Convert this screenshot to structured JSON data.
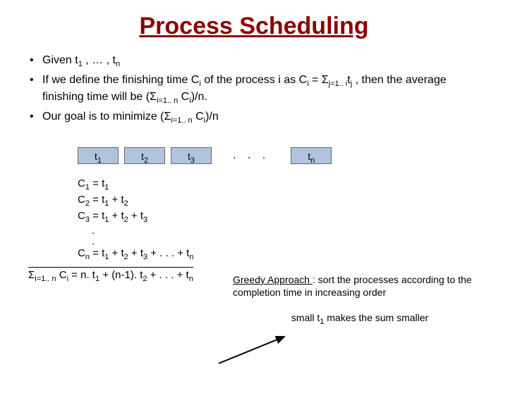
{
  "title": "Process Scheduling",
  "bullets": {
    "b1_pre": "Given t",
    "b1_sub1": "1",
    "b1_mid": " , … , t",
    "b1_sub2": "n",
    "b2_a": "If we define the finishing time C",
    "b2_s1": "i",
    "b2_b": " of the process i as C",
    "b2_s2": "i",
    "b2_c": " = Σ",
    "b2_s3": "j=1.. i",
    "b2_d": "t",
    "b2_s4": "j",
    "b2_e": " , then the average finishing time will be  (Σ",
    "b2_s5": "i=1.. n",
    "b2_f": " C",
    "b2_s6": "i",
    "b2_g": ")/n.",
    "b3_a": "Our goal is to minimize (Σ",
    "b3_s1": "i=1.. n",
    "b3_b": " C",
    "b3_s2": "i",
    "b3_c": ")/n"
  },
  "boxes": {
    "t1a": "t",
    "t1s": "1",
    "t2a": "t",
    "t2s": "2",
    "t3a": "t",
    "t3s": "3",
    "dots": ". . .",
    "tna": "t",
    "tns": "n"
  },
  "calcs": {
    "l1a": "C",
    "l1s1": "1",
    "l1b": " = t",
    "l1s2": "1",
    "l2a": "C",
    "l2s1": "2",
    "l2b": " = t",
    "l2s2": "1",
    "l2c": " + t",
    "l2s3": "2",
    "l3a": "C",
    "l3s1": "3",
    "l3b": " = t",
    "l3s2": "1",
    "l3c": " + t",
    "l3s3": "2",
    "l3d": " + t",
    "l3s4": "3",
    "dot": ".",
    "lna": "C",
    "lns1": "n",
    "lnb": " = t",
    "lns2": "1",
    "lnc": " + t",
    "lns3": "2",
    "lnd": " + t",
    "lns4": "3",
    "lne": " + . . . + t",
    "lns5": "n"
  },
  "sum": {
    "a": "Σ",
    "s1": "i=1.. n",
    "b": " C",
    "s2": "i",
    "c": " = n. t",
    "s3": "1",
    "d": " + (n-1). t",
    "s4": "2",
    "e": " + . . . + t",
    "s5": "n"
  },
  "right": {
    "ga_label": "Greedy Approach ",
    "ga_rest": ": sort the processes according to the completion time in increasing order",
    "note_a": "small t",
    "note_s": "1",
    "note_b": " makes the sum smaller"
  }
}
